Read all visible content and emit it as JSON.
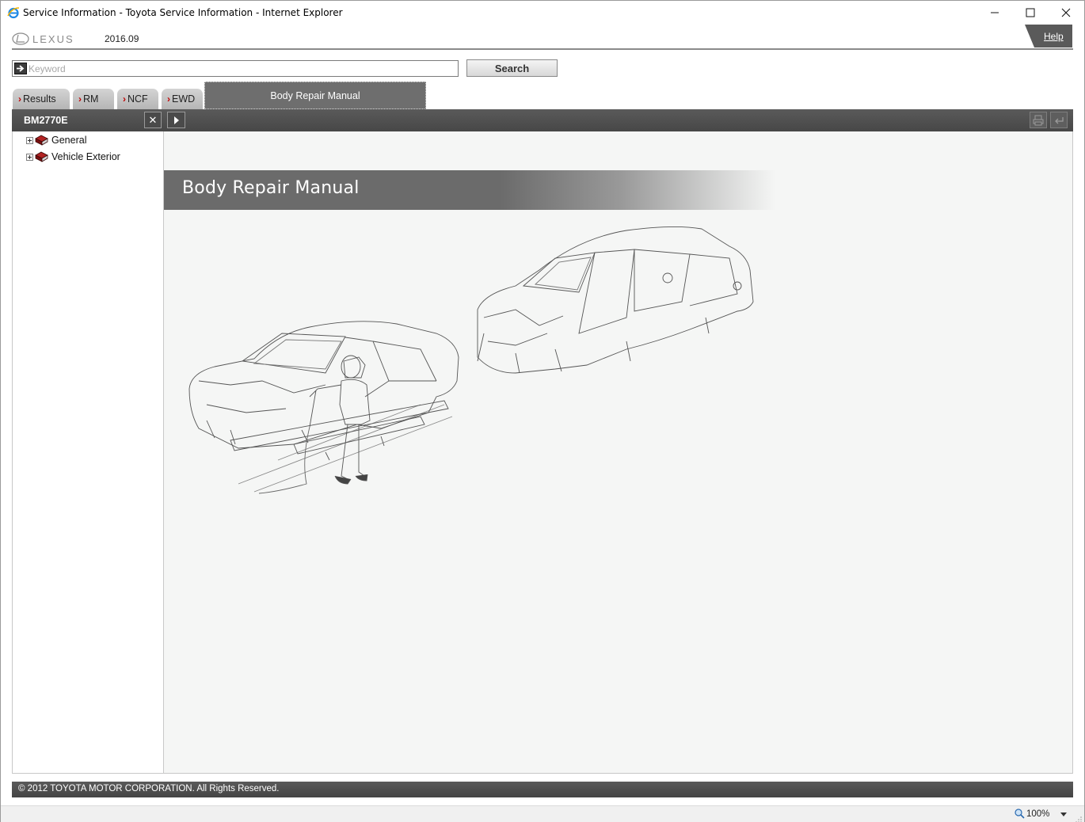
{
  "window": {
    "title": "Service Information - Toyota Service Information - Internet Explorer"
  },
  "header": {
    "brand": "LEXUS",
    "version": "2016.09",
    "help_label": "Help"
  },
  "search": {
    "placeholder": "Keyword",
    "value": "",
    "button_label": "Search"
  },
  "tabs": [
    {
      "label": "Results"
    },
    {
      "label": "RM"
    },
    {
      "label": "NCF"
    },
    {
      "label": "EWD"
    }
  ],
  "active_tab": {
    "label": "Body Repair Manual"
  },
  "toolbar": {
    "doc_code": "BM2770E",
    "close_symbol": "✕"
  },
  "tree": {
    "items": [
      {
        "label": "General",
        "icon": "book-icon"
      },
      {
        "label": "Vehicle Exterior",
        "icon": "book-icon"
      }
    ]
  },
  "content": {
    "banner_title": "Body Repair Manual"
  },
  "footer": {
    "copyright": "© 2012 TOYOTA MOTOR CORPORATION. All Rights Reserved."
  },
  "statusbar": {
    "zoom": "100%"
  },
  "colors": {
    "band": "#4f4f4f",
    "active_tab": "#6e6e6e",
    "tab_chevron": "#c00000",
    "content_bg": "#f5f6f5",
    "book_red": "#9b1b1b"
  }
}
